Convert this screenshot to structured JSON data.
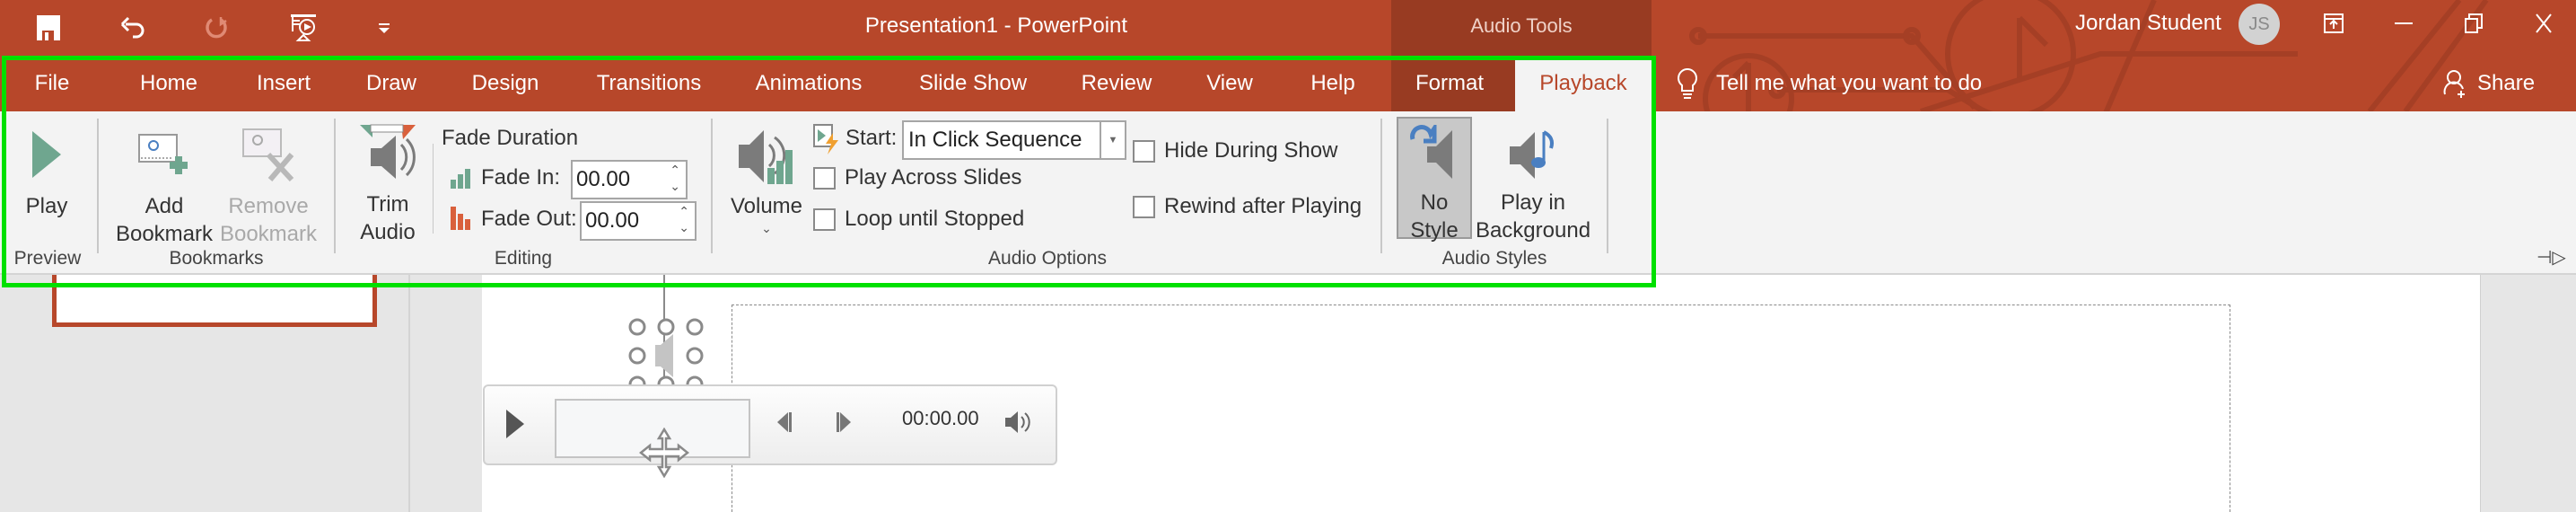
{
  "window": {
    "document_title": "Presentation1  -  PowerPoint",
    "contextual_group": "Audio Tools",
    "user_name": "Jordan Student",
    "user_initials": "JS",
    "brand_color": "#b7472a",
    "contextual_color": "#983b22",
    "highlight_color": "#00e000"
  },
  "qat": [
    {
      "name": "save",
      "icon": "floppy-disk-icon"
    },
    {
      "name": "undo",
      "icon": "undo-arrow-icon"
    },
    {
      "name": "redo",
      "icon": "redo-circle-icon",
      "disabled": true
    },
    {
      "name": "start-from-beginning",
      "icon": "presentation-play-icon"
    },
    {
      "name": "customize",
      "icon": "dropdown-caret-icon"
    }
  ],
  "window_controls": [
    "ribbon-display-options",
    "minimize",
    "restore",
    "close"
  ],
  "tabs": [
    {
      "label": "File"
    },
    {
      "label": "Home"
    },
    {
      "label": "Insert"
    },
    {
      "label": "Draw"
    },
    {
      "label": "Design"
    },
    {
      "label": "Transitions"
    },
    {
      "label": "Animations"
    },
    {
      "label": "Slide Show"
    },
    {
      "label": "Review"
    },
    {
      "label": "View"
    },
    {
      "label": "Help"
    },
    {
      "label": "Format",
      "contextual": true
    },
    {
      "label": "Playback",
      "contextual": true,
      "active": true
    }
  ],
  "tell_me": "Tell me what you want to do",
  "share_label": "Share",
  "ribbon": {
    "preview": {
      "group_label": "Preview",
      "play_label": "Play"
    },
    "bookmarks": {
      "group_label": "Bookmarks",
      "add_line1": "Add",
      "add_line2": "Bookmark",
      "remove_line1": "Remove",
      "remove_line2": "Bookmark",
      "remove_disabled": true
    },
    "editing": {
      "group_label": "Editing",
      "trim_line1": "Trim",
      "trim_line2": "Audio",
      "fade_duration_label": "Fade Duration",
      "fade_in_label": "Fade In:",
      "fade_in_value": "00.00",
      "fade_out_label": "Fade Out:",
      "fade_out_value": "00.00"
    },
    "audio_options": {
      "group_label": "Audio Options",
      "volume_label": "Volume",
      "start_label": "Start:",
      "start_value": "In Click Sequence",
      "play_across_slides": {
        "label": "Play Across Slides",
        "checked": false
      },
      "loop_until_stopped": {
        "label": "Loop until Stopped",
        "checked": false
      },
      "hide_during_show": {
        "label": "Hide During Show",
        "checked": false
      },
      "rewind_after_playing": {
        "label": "Rewind after Playing",
        "checked": false
      }
    },
    "audio_styles": {
      "group_label": "Audio Styles",
      "no_style_line1": "No",
      "no_style_line2": "Style",
      "no_style_selected": true,
      "bg_line1": "Play in",
      "bg_line2": "Background"
    }
  },
  "audio_player": {
    "time": "00:00.00"
  }
}
